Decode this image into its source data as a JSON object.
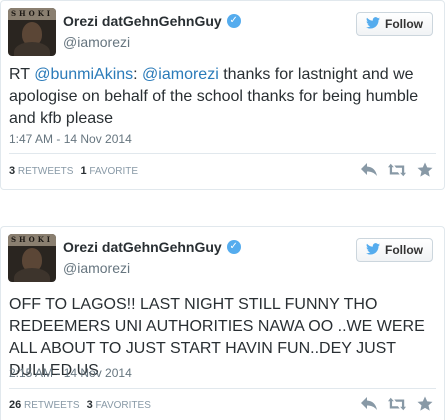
{
  "colors": {
    "link": "#2b7bb9",
    "verified": "#55acee",
    "muted": "#66757f",
    "border": "#e1e8ed"
  },
  "tweets": [
    {
      "display_name": "Orezi datGehnGehnGuy",
      "handle": "@iamorezi",
      "follow_label": "Follow",
      "avatar_label": "SHOKI",
      "text_prefix": "RT ",
      "mention_1": "@bunmiAkins",
      "text_sep": ": ",
      "mention_2": "@iamorezi",
      "text_rest": " thanks for lastnight and we apologise on behalf of the school thanks for being humble and kfb please",
      "timestamp": "1:47 AM - 14 Nov 2014",
      "retweets_count": "3",
      "retweets_label": "RETWEETS",
      "favorites_count": "1",
      "favorites_label": "FAVORITE",
      "icons": [
        "reply-icon",
        "retweet-icon",
        "favorite-icon"
      ]
    },
    {
      "display_name": "Orezi datGehnGehnGuy",
      "handle": "@iamorezi",
      "follow_label": "Follow",
      "avatar_label": "SHOKI",
      "text": "OFF TO LAGOS!! LAST NIGHT STILL FUNNY THO REDEEMERS UNI AUTHORITIES NAWA OO ..WE WERE ALL ABOUT TO JUST START HAVIN FUN..DEY JUST DULLED US",
      "timestamp": "2:15 AM - 14 Nov 2014",
      "retweets_count": "26",
      "retweets_label": "RETWEETS",
      "favorites_count": "3",
      "favorites_label": "FAVORITES",
      "icons": [
        "reply-icon",
        "retweet-icon",
        "favorite-icon"
      ]
    }
  ]
}
